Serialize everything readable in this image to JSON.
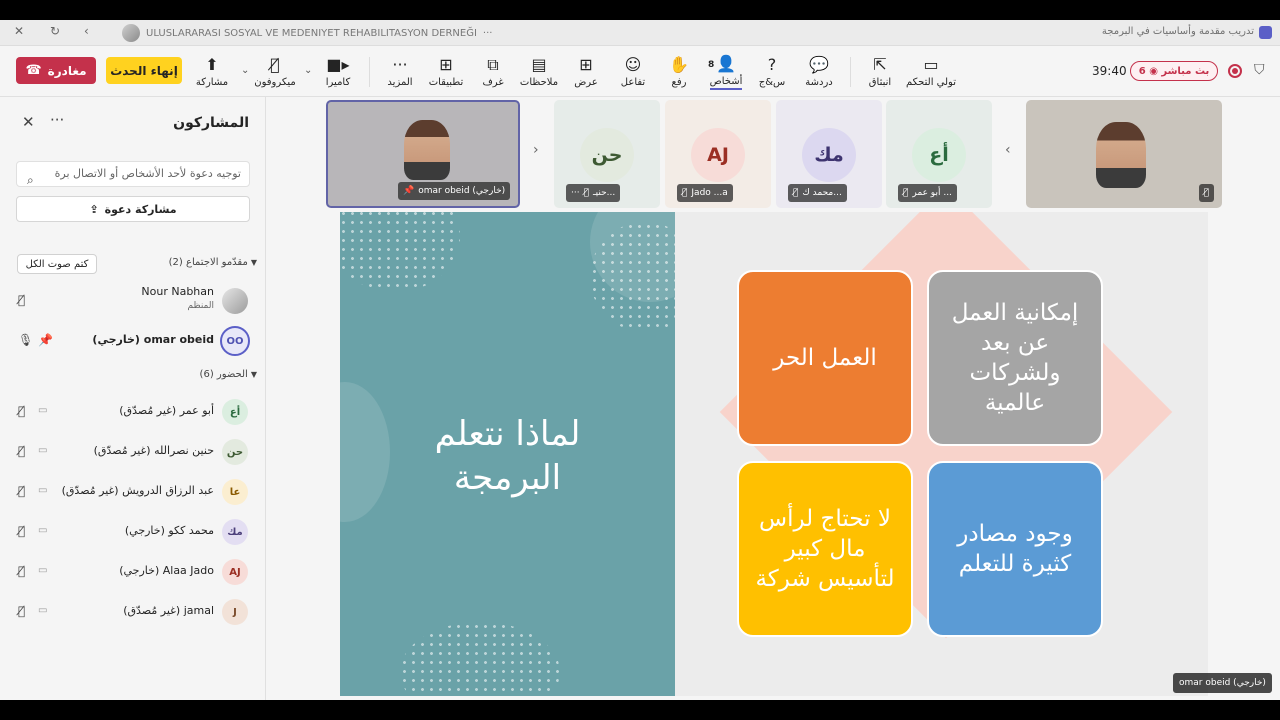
{
  "window": {
    "meeting_title": "تدريب مقدمة وأساسيات في البرمجة",
    "org_name": "ULUSLARARASI SOSYAL VE MEDENIYET REHABILITASYON DERNEĞI",
    "org_more": "···"
  },
  "toolbar": {
    "leave_label": "مغادرة",
    "end_event_label": "إنهاء الحدث",
    "share_label": "مشاركة",
    "mic_label": "ميكروفون",
    "camera_label": "كاميرا",
    "more_label": "المزيد",
    "apps_label": "تطبيقات",
    "rooms_label": "غرف",
    "notes_label": "ملاحظات",
    "view_label": "عرض",
    "react_label": "تفاعل",
    "raise_label": "رفع",
    "people_label": "أشخاص",
    "people_count": "8",
    "qa_label": "س&ج",
    "chat_label": "دردشة",
    "popout_label": "انبثاق",
    "control_label": "تولي التحكم",
    "timer": "39:40",
    "live_label": "بث مباشر",
    "live_viewers": "6"
  },
  "participants_panel": {
    "title": "المشاركون",
    "search_placeholder": "توجيه دعوة لأحد الأشخاص أو الاتصال برة",
    "share_invite_label": "مشاركة دعوة",
    "mute_all_label": "كتم صوت الكل",
    "presenters_header": "مقدّمو الاجتماع (2)",
    "attendees_header": "الحضور (6)",
    "presenters": [
      {
        "name": "Nour Nabhan",
        "role": "المنظم",
        "initials": ""
      },
      {
        "name": "omar obeid (خارجي)",
        "role": "",
        "initials": "OO"
      }
    ],
    "attendees": [
      {
        "name": "أبو عمر (غير مُصدّق)",
        "initials": "أع"
      },
      {
        "name": "حنين نصرالله (غير مُصدّق)",
        "initials": "حن"
      },
      {
        "name": "عبد الرزاق الدرويش (غير مُصدّق)",
        "initials": "عا"
      },
      {
        "name": "محمد ككو (خارجي)",
        "initials": "مك"
      },
      {
        "name": "Alaa Jado (خارجي)",
        "initials": "AJ"
      },
      {
        "name": "jamal (غير مُصدّق)",
        "initials": "J"
      }
    ]
  },
  "gallery": {
    "featured_label": "omar obeid (خارجي)",
    "tiles": [
      {
        "initials": "حن",
        "label": "حنيـ..."
      },
      {
        "initials": "AJ",
        "label": "Jado ...a"
      },
      {
        "initials": "مك",
        "label": "محمد ك..."
      },
      {
        "initials": "أع",
        "label": "أبو عمر ..."
      }
    ]
  },
  "slide": {
    "title_line1": "لماذا نتعلم",
    "title_line2": "البرمجة",
    "box_freelance": "العمل الحر",
    "box_remote": "إمكانية العمل عن بعد ولشركات عالمية",
    "box_capital": "لا تحتاج لرأس مال كبير لتأسيس شركة",
    "box_resources": "وجود مصادر كثيرة للتعلم"
  },
  "presenter_tag": "omar obeid (خارجي)",
  "colors": {
    "accent": "#5b5fc7",
    "leave": "#c4314b",
    "end_event": "#ffd21f",
    "slide_teal": "#6aa2a8",
    "box_orange": "#ed7d31",
    "box_gray": "#a5a5a5",
    "box_yellow": "#ffc000",
    "box_blue": "#5b9bd5"
  }
}
